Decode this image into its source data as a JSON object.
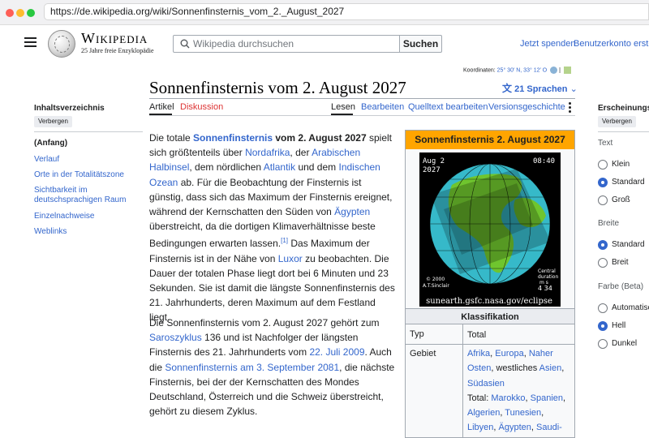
{
  "browser": {
    "url": "https://de.wikipedia.org/wiki/Sonnenfinsternis_vom_2._August_2027"
  },
  "header": {
    "wordmark": "Wikipedia",
    "tagline": "25 Jahre freie Enzyklopädie",
    "search_placeholder": "Wikipedia durchsuchen",
    "search_button": "Suchen",
    "donate": "Jetzt spenden",
    "create_account": "Benutzerkonto erstellen"
  },
  "coordinates": {
    "label": "Koordinaten:",
    "value": "25° 30′ N, 33° 12′ O",
    "sep": "|"
  },
  "page": {
    "title": "Sonnenfinsternis vom 2. August 2027",
    "languages": "21 Sprachen"
  },
  "tabs": {
    "article": "Artikel",
    "discussion": "Diskussion",
    "read": "Lesen",
    "edit": "Bearbeiten",
    "edit_source": "Quelltext bearbeiten",
    "history": "Versionsgeschichte"
  },
  "toc": {
    "heading": "Inhaltsverzeichnis",
    "hide": "Verbergen",
    "items": [
      "(Anfang)",
      "Verlauf",
      "Orte in der Totalitätszone",
      "Sichtbarkeit im deutschsprachigen Raum",
      "Einzelnachweise",
      "Weblinks"
    ]
  },
  "appearance": {
    "heading": "Erscheinungsbild",
    "hide": "Verbergen",
    "text_label": "Text",
    "text_options": [
      "Klein",
      "Standard",
      "Groß"
    ],
    "text_selected": "Standard",
    "width_label": "Breite",
    "width_options": [
      "Standard",
      "Breit"
    ],
    "width_selected": "Standard",
    "color_label": "Farbe (Beta)",
    "color_options": [
      "Automatisch",
      "Hell",
      "Dunkel"
    ],
    "color_selected": "Hell"
  },
  "article": {
    "p1": {
      "t1": "Die totale ",
      "l1": "Sonnenfinsternis",
      "t2": " vom 2. August 2027",
      "t3": " spielt sich größtenteils über ",
      "l2": "Nordafrika",
      "t4": ", der ",
      "l3": "Arabischen Halbinsel",
      "t5": ", dem nördlichen ",
      "l4": "Atlantik",
      "t6": " und dem ",
      "l5": "Indischen Ozean",
      "t7": " ab. Für die Beobachtung der Finsternis ist günstig, dass sich das Maximum der Finsternis ereignet, während der Kernschatten den Süden von ",
      "l6": "Ägypten",
      "t8": " überstreicht, da die dortigen Klimaverhältnisse beste Bedingungen erwarten lassen.",
      "ref": "[1]",
      "t9": " Das Maximum der Finsternis ist in der Nähe von ",
      "l7": "Luxor",
      "t10": " zu beobachten. Die Dauer der totalen Phase liegt dort bei 6 Minuten und 23 Sekunden. Sie ist damit die längste Sonnenfinsternis des 21. Jahrhunderts, deren Maximum auf dem Festland liegt."
    },
    "p2": {
      "t1": "Die Sonnenfinsternis vom 2. August 2027 gehört zum ",
      "l1": "Saroszyklus",
      "t2": " 136 und ist Nachfolger der längsten Finsternis des 21. Jahrhunderts vom ",
      "l2": "22. Juli 2009",
      "t3": ". Auch die ",
      "l3": "Sonnenfinsternis am 3. September 2081",
      "t4": ", die nächste Finsternis, bei der der Kernschatten des Mondes Deutschland, Österreich und die Schweiz überstreicht, gehört zu diesem Zyklus."
    }
  },
  "infobox": {
    "title": "Sonnenfinsternis 2. August 2027",
    "image": {
      "date_line1": "Aug  2",
      "date_line2": "2027",
      "time": "08:40",
      "copyright1": "© 2000",
      "copyright2": "A.T.Sinclair",
      "dur1": "Central",
      "dur2": "duration",
      "dur3": "m    s",
      "dur4": "4  34",
      "credit": "sunearth.gsfc.nasa.gov/eclipse"
    },
    "section": "Klassifikation",
    "typ_label": "Typ",
    "typ_value": "Total",
    "gebiet_label": "Gebiet",
    "gebiet": {
      "a1": "Afrika",
      "s1": ", ",
      "a2": "Europa",
      "s2": ", ",
      "a3": "Naher Osten",
      "s3": ", westliches ",
      "a4": "Asien",
      "s4": ", ",
      "a5": "Südasien",
      "total_label": "Total: ",
      "b1": "Marokko",
      "b2": "Spanien",
      "b3": "Algerien",
      "b4": "Tunesien",
      "b5": "Libyen",
      "b6": "Ägypten",
      "b7": "Saudi-",
      "sep": ", "
    }
  },
  "colors": {
    "link": "#3366cc",
    "infobox_header": "#ffa500",
    "discussion_red": "#dd3333"
  }
}
